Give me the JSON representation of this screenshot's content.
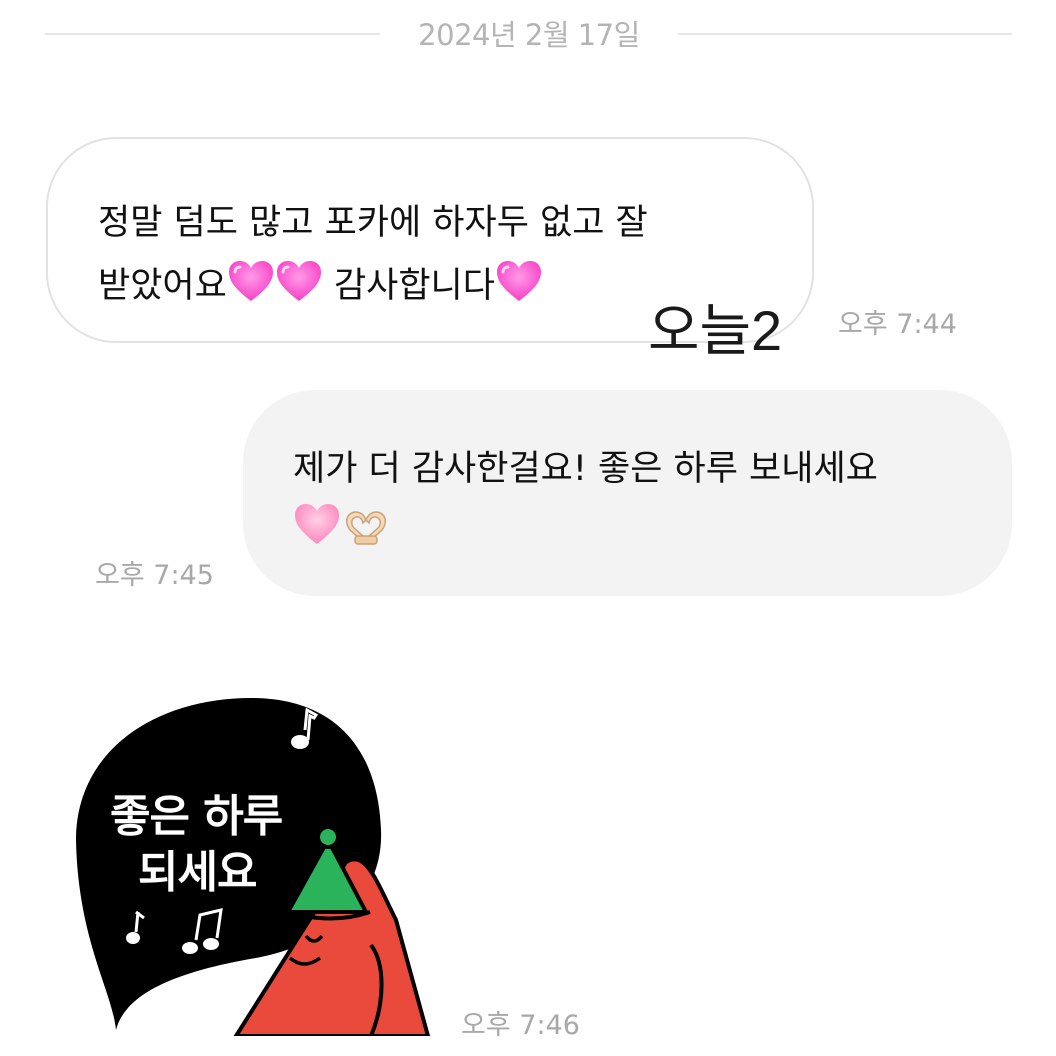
{
  "date_divider": {
    "label": "2024년 2월 17일"
  },
  "messages": [
    {
      "direction": "received",
      "lines": [
        "정말 덤도 많고 포카에 하자두 없고 잘",
        "받았어요",
        "감사합니다"
      ],
      "time": "오후 7:44"
    },
    {
      "direction": "sent",
      "lines": [
        "제가 더 감사한걸요! 좋은 하루 보내세요"
      ],
      "time": "오후 7:45"
    },
    {
      "direction": "received",
      "type": "sticker",
      "sticker_lines": [
        "좋은 하루",
        "되세요"
      ],
      "time": "오후 7:46"
    }
  ],
  "overlay": {
    "watermark": "오늘2"
  },
  "icons": [
    "sparkling-heart-icon",
    "pink-heart-icon",
    "heart-hands-icon",
    "music-note-icon"
  ],
  "colors": {
    "bubble_sent_bg": "#f3f3f3",
    "bubble_received_border": "#e2e2e2",
    "heart_pink": "#ff5fcf",
    "sticker_black": "#000000",
    "sticker_red": "#ea4a3c",
    "sticker_green": "#2bb35c"
  }
}
